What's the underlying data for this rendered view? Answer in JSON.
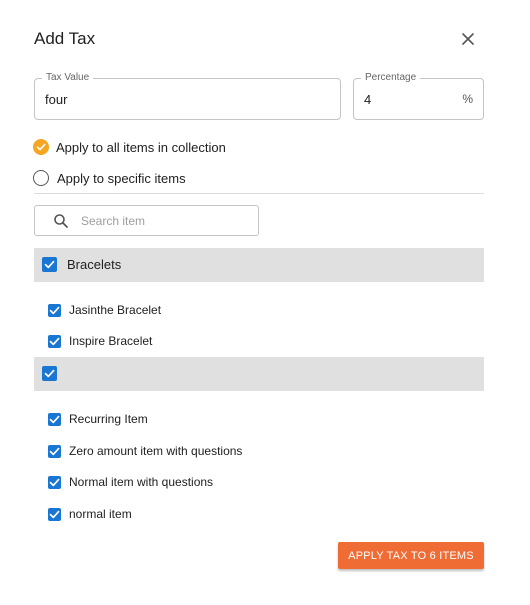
{
  "dialog": {
    "title": "Add Tax",
    "close_icon": "close-icon"
  },
  "tax_value": {
    "label": "Tax Value",
    "value": "four"
  },
  "percentage": {
    "label": "Percentage",
    "value": "4",
    "suffix": "%"
  },
  "apply_options": [
    {
      "label": "Apply to all items in collection",
      "selected": true
    },
    {
      "label": "Apply to specific items",
      "selected": false
    }
  ],
  "search": {
    "placeholder": "Search item",
    "icon": "search-icon"
  },
  "groups": [
    {
      "name": "Bracelets",
      "checked": true,
      "items": [
        {
          "label": "Jasinthe Bracelet",
          "checked": true
        },
        {
          "label": "Inspire Bracelet",
          "checked": true
        }
      ]
    },
    {
      "name": "",
      "checked": true,
      "items": [
        {
          "label": "Recurring Item",
          "checked": true
        },
        {
          "label": "Zero amount item with questions",
          "checked": true
        },
        {
          "label": "Normal item with questions",
          "checked": true
        },
        {
          "label": "normal item",
          "checked": true
        }
      ]
    }
  ],
  "apply_button": {
    "label": "APPLY TAX TO 6 ITEMS"
  },
  "colors": {
    "accent": "#ef6c35",
    "radio_selected": "#f5a623",
    "checkbox": "#1976d2",
    "group_header_bg": "#e0e0e0"
  }
}
